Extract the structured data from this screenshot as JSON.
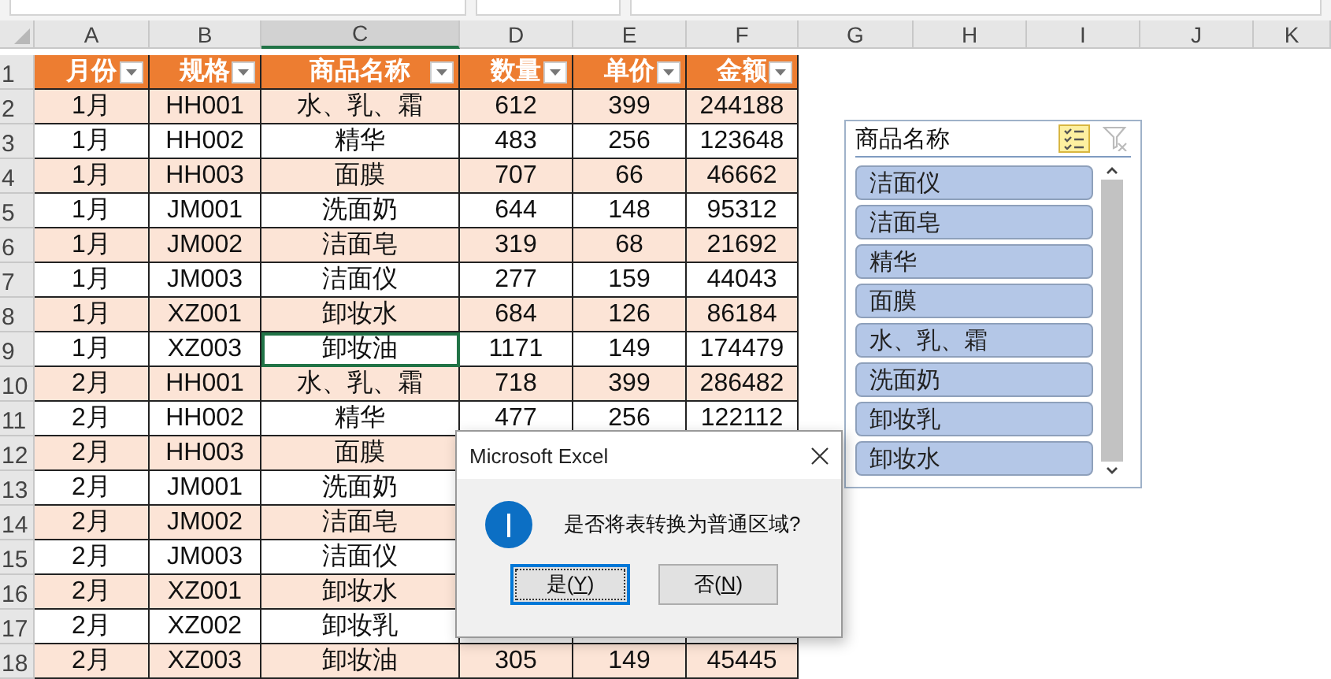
{
  "sheet": {
    "columns": [
      {
        "letter": "A",
        "selected": false
      },
      {
        "letter": "B",
        "selected": false
      },
      {
        "letter": "C",
        "selected": true
      },
      {
        "letter": "D",
        "selected": false
      },
      {
        "letter": "E",
        "selected": false
      },
      {
        "letter": "F",
        "selected": false
      },
      {
        "letter": "G",
        "selected": false
      },
      {
        "letter": "H",
        "selected": false
      },
      {
        "letter": "I",
        "selected": false
      },
      {
        "letter": "J",
        "selected": false
      },
      {
        "letter": "K",
        "selected": false
      }
    ],
    "header_row": {
      "number": "1",
      "cells": [
        "月份",
        "规格",
        "商品名称",
        "数量",
        "单价",
        "金额"
      ]
    },
    "rows": [
      {
        "number": "2",
        "active": false,
        "cells": [
          "1月",
          "HH001",
          "水、乳、霜",
          "612",
          "399",
          "244188"
        ]
      },
      {
        "number": "3",
        "active": false,
        "cells": [
          "1月",
          "HH002",
          "精华",
          "483",
          "256",
          "123648"
        ]
      },
      {
        "number": "4",
        "active": false,
        "cells": [
          "1月",
          "HH003",
          "面膜",
          "707",
          "66",
          "46662"
        ]
      },
      {
        "number": "5",
        "active": false,
        "cells": [
          "1月",
          "JM001",
          "洗面奶",
          "644",
          "148",
          "95312"
        ]
      },
      {
        "number": "6",
        "active": false,
        "cells": [
          "1月",
          "JM002",
          "洁面皂",
          "319",
          "68",
          "21692"
        ]
      },
      {
        "number": "7",
        "active": false,
        "cells": [
          "1月",
          "JM003",
          "洁面仪",
          "277",
          "159",
          "44043"
        ]
      },
      {
        "number": "8",
        "active": false,
        "cells": [
          "1月",
          "XZ001",
          "卸妆水",
          "684",
          "126",
          "86184"
        ]
      },
      {
        "number": "9",
        "active": true,
        "cells": [
          "1月",
          "XZ003",
          "卸妆油",
          "1171",
          "149",
          "174479"
        ]
      },
      {
        "number": "10",
        "active": false,
        "cells": [
          "2月",
          "HH001",
          "水、乳、霜",
          "718",
          "399",
          "286482"
        ]
      },
      {
        "number": "11",
        "active": false,
        "cells": [
          "2月",
          "HH002",
          "精华",
          "477",
          "256",
          "122112"
        ]
      },
      {
        "number": "12",
        "active": false,
        "cells": [
          "2月",
          "HH003",
          "面膜",
          null,
          null,
          null
        ]
      },
      {
        "number": "13",
        "active": false,
        "cells": [
          "2月",
          "JM001",
          "洗面奶",
          null,
          null,
          null
        ]
      },
      {
        "number": "14",
        "active": false,
        "cells": [
          "2月",
          "JM002",
          "洁面皂",
          null,
          null,
          null
        ]
      },
      {
        "number": "15",
        "active": false,
        "cells": [
          "2月",
          "JM003",
          "洁面仪",
          null,
          null,
          null
        ]
      },
      {
        "number": "16",
        "active": false,
        "cells": [
          "2月",
          "XZ001",
          "卸妆水",
          null,
          null,
          null
        ]
      },
      {
        "number": "17",
        "active": false,
        "cells": [
          "2月",
          "XZ002",
          "卸妆乳",
          null,
          null,
          null
        ]
      },
      {
        "number": "18",
        "active": false,
        "cells": [
          "2月",
          "XZ003",
          "卸妆油",
          "305",
          "149",
          "45445"
        ]
      }
    ]
  },
  "slicer": {
    "title": "商品名称",
    "multi_select": true,
    "filter_cleared": true,
    "items": [
      {
        "label": "洁面仪",
        "selected": true
      },
      {
        "label": "洁面皂",
        "selected": true
      },
      {
        "label": "精华",
        "selected": true
      },
      {
        "label": "面膜",
        "selected": true
      },
      {
        "label": "水、乳、霜",
        "selected": true
      },
      {
        "label": "洗面奶",
        "selected": true
      },
      {
        "label": "卸妆乳",
        "selected": true
      },
      {
        "label": "卸妆水",
        "selected": true
      }
    ]
  },
  "dialog": {
    "title": "Microsoft Excel",
    "message": "是否将表转换为普通区域?",
    "buttons": [
      {
        "before": "是(",
        "key": "Y",
        "after": ")",
        "selected": true
      },
      {
        "before": "否(",
        "key": "N",
        "after": ")",
        "selected": false
      }
    ]
  }
}
